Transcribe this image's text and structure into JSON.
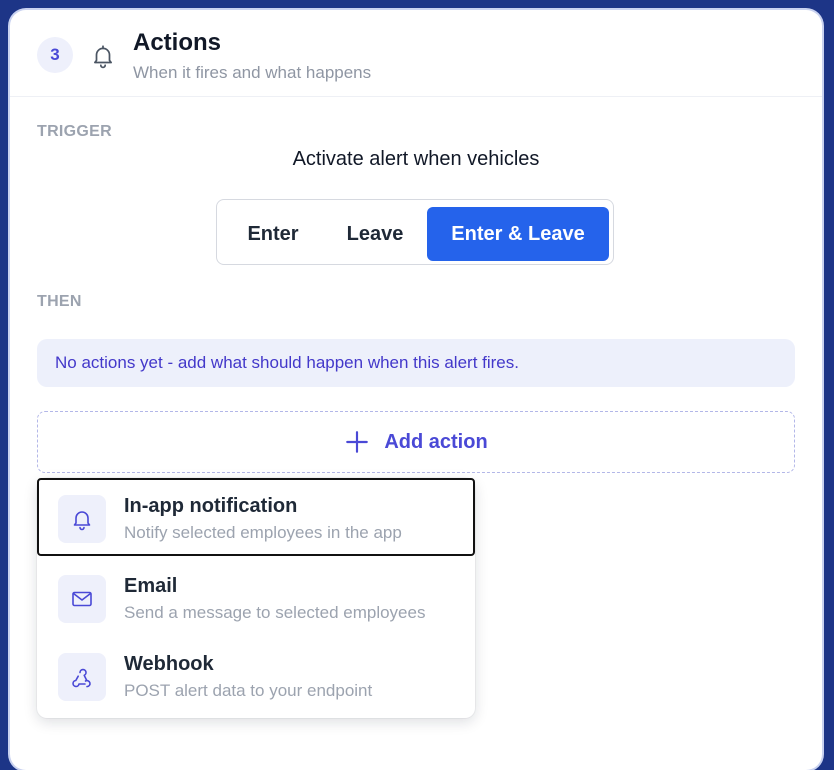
{
  "header": {
    "step": "3",
    "title": "Actions",
    "subtitle": "When it fires and what happens"
  },
  "trigger": {
    "label": "TRIGGER",
    "text": "Activate alert when vehicles",
    "options": [
      "Enter",
      "Leave",
      "Enter & Leave"
    ],
    "selected": "Enter & Leave"
  },
  "then": {
    "label": "THEN",
    "empty_message": "No actions yet - add what should happen when this alert fires.",
    "add_button": "Add action"
  },
  "menu": {
    "items": [
      {
        "title": "In-app notification",
        "desc": "Notify selected employees in the app",
        "icon": "bell-icon"
      },
      {
        "title": "Email",
        "desc": "Send a message to selected employees",
        "icon": "mail-icon"
      },
      {
        "title": "Webhook",
        "desc": "POST alert data to your endpoint",
        "icon": "webhook-icon"
      }
    ]
  },
  "colors": {
    "accent": "#4a49d6",
    "primary": "#2563eb",
    "background": "#1d3587"
  }
}
